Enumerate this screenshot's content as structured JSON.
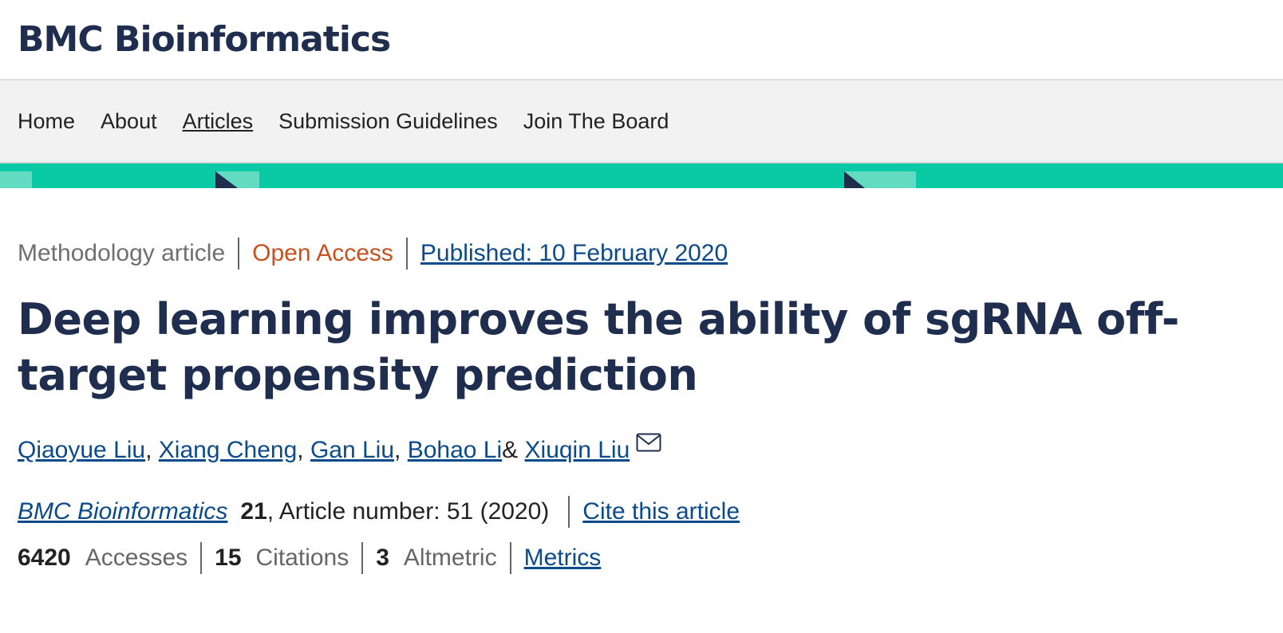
{
  "masthead": {
    "journal_title": "BMC Bioinformatics"
  },
  "nav": {
    "items": [
      {
        "label": "Home"
      },
      {
        "label": "About"
      },
      {
        "label": "Articles"
      },
      {
        "label": "Submission Guidelines"
      },
      {
        "label": "Join The Board"
      }
    ],
    "active": "Articles"
  },
  "colors": {
    "brand_navy": "#1f2d4e",
    "accent_teal": "#0ac9a5",
    "open_access": "#c7501d",
    "link": "#0b4a8b"
  },
  "article": {
    "type": "Methodology article",
    "access": "Open Access",
    "published": "Published: 10 February 2020",
    "title": "Deep learning improves the ability of sgRNA off-target propensity prediction",
    "authors": [
      {
        "name": "Qiaoyue Liu",
        "sep": ","
      },
      {
        "name": "Xiang Cheng",
        "sep": ","
      },
      {
        "name": "Gan Liu",
        "sep": ","
      },
      {
        "name": "Bohao Li",
        "sep": " &"
      },
      {
        "name": "Xiuqin Liu",
        "sep": ""
      }
    ],
    "corresponding_icon": "envelope-icon",
    "citation": {
      "journal": "BMC Bioinformatics",
      "volume": "21",
      "rest": ", Article number: 51 (2020)",
      "cite_label": "Cite this article"
    },
    "metrics": {
      "accesses_value": "6420",
      "accesses_label": "Accesses",
      "citations_value": "15",
      "citations_label": "Citations",
      "altmetric_value": "3",
      "altmetric_label": "Altmetric",
      "metrics_link": "Metrics"
    }
  }
}
